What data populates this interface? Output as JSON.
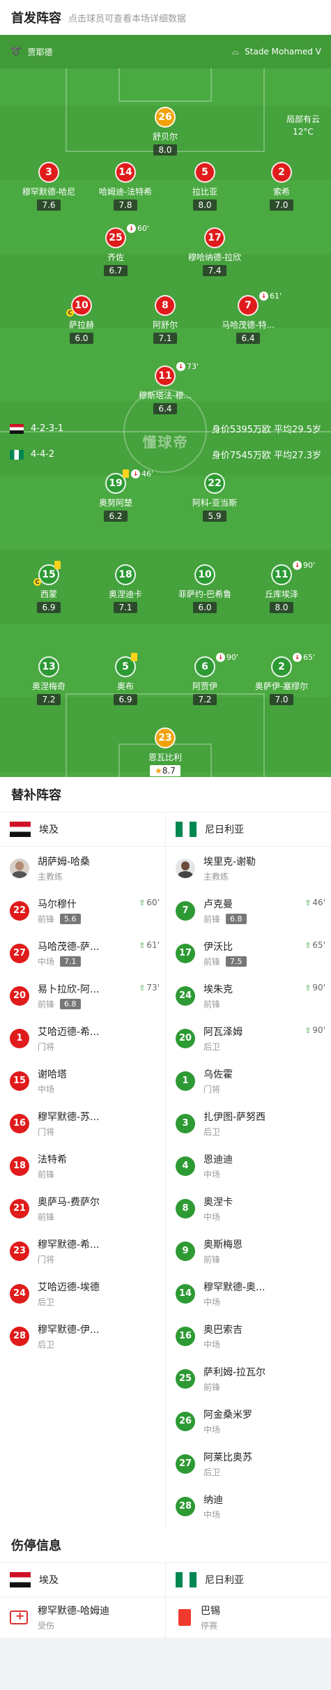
{
  "header": {
    "title": "首发阵容",
    "subtitle": "点击球员可查看本场详细数据"
  },
  "pitch": {
    "coach_home": "贾耶德",
    "venue": "Stade Mohamed V",
    "weather": {
      "line1": "局部有云",
      "line2": "12°C"
    },
    "watermark": "懂球帝",
    "home_formation": "4-2-3-1",
    "home_value": "身价5395万欧",
    "home_age": "平均29.5岁",
    "away_formation": "4-4-2",
    "away_value": "身价7545万欧",
    "away_age": "平均27.3岁"
  },
  "home_players": [
    {
      "num": "26",
      "name": "舒贝尔",
      "rating": "8.0"
    },
    {
      "num": "3",
      "name": "穆罕默德-哈尼",
      "rating": "7.6"
    },
    {
      "num": "14",
      "name": "哈姆迪-法特希",
      "rating": "7.8"
    },
    {
      "num": "5",
      "name": "拉比亚",
      "rating": "8.0"
    },
    {
      "num": "2",
      "name": "索希",
      "rating": "7.0"
    },
    {
      "num": "25",
      "name": "齐佐",
      "rating": "6.7",
      "sub": "60'"
    },
    {
      "num": "17",
      "name": "穆哈纳德-拉欣",
      "rating": "7.4"
    },
    {
      "num": "10",
      "name": "萨拉赫",
      "rating": "6.0"
    },
    {
      "num": "8",
      "name": "阿舒尔",
      "rating": "7.1"
    },
    {
      "num": "7",
      "name": "马哈茂德-特...",
      "rating": "6.4",
      "sub": "61'"
    },
    {
      "num": "11",
      "name": "穆斯塔法-穆...",
      "rating": "6.4",
      "sub": "73'"
    }
  ],
  "away_players": [
    {
      "num": "19",
      "name": "奥努阿楚",
      "rating": "6.2",
      "sub": "46'"
    },
    {
      "num": "22",
      "name": "阿科-亚当斯",
      "rating": "5.9"
    },
    {
      "num": "15",
      "name": "西蒙",
      "rating": "6.9"
    },
    {
      "num": "18",
      "name": "奥涅迪卡",
      "rating": "7.1"
    },
    {
      "num": "10",
      "name": "菲萨约-巴希鲁",
      "rating": "6.0"
    },
    {
      "num": "11",
      "name": "丘库埃泽",
      "rating": "8.0",
      "sub": "90'"
    },
    {
      "num": "13",
      "name": "奥涅梅奇",
      "rating": "7.2"
    },
    {
      "num": "5",
      "name": "奥布",
      "rating": "6.9"
    },
    {
      "num": "6",
      "name": "阿贾伊",
      "rating": "7.2",
      "sub": "90'"
    },
    {
      "num": "2",
      "name": "奥萨伊-塞缪尔",
      "rating": "7.0",
      "sub": "65'"
    },
    {
      "num": "23",
      "name": "恩瓦比利",
      "rating": "8.7"
    }
  ],
  "subs": {
    "title": "替补阵容",
    "home_team": "埃及",
    "away_team": "尼日利亚",
    "home": [
      {
        "num": "",
        "name": "胡萨姆-哈桑",
        "pos": "主教练",
        "coach": true
      },
      {
        "num": "22",
        "name": "马尔穆什",
        "pos": "前锋",
        "rating": "5.6",
        "time": "60'"
      },
      {
        "num": "27",
        "name": "马哈茂德-萨...",
        "pos": "中场",
        "rating": "7.1",
        "time": "61'"
      },
      {
        "num": "20",
        "name": "易卜拉欣-阿...",
        "pos": "前锋",
        "rating": "6.8",
        "time": "73'"
      },
      {
        "num": "1",
        "name": "艾哈迈德-希...",
        "pos": "门将"
      },
      {
        "num": "15",
        "name": "谢哈塔",
        "pos": "中场"
      },
      {
        "num": "16",
        "name": "穆罕默德-苏...",
        "pos": "门将"
      },
      {
        "num": "18",
        "name": "法特希",
        "pos": "前锋"
      },
      {
        "num": "21",
        "name": "奥萨马-费萨尔",
        "pos": "前锋"
      },
      {
        "num": "23",
        "name": "穆罕默德-希...",
        "pos": "门将"
      },
      {
        "num": "24",
        "name": "艾哈迈德-埃德",
        "pos": "后卫"
      },
      {
        "num": "28",
        "name": "穆罕默德-伊...",
        "pos": "后卫"
      }
    ],
    "away": [
      {
        "num": "",
        "name": "埃里克-谢勒",
        "pos": "主教练",
        "coach": true
      },
      {
        "num": "7",
        "name": "卢克曼",
        "pos": "前锋",
        "rating": "6.8",
        "time": "46'"
      },
      {
        "num": "17",
        "name": "伊沃比",
        "pos": "前锋",
        "rating": "7.5",
        "time": "65'"
      },
      {
        "num": "24",
        "name": "埃朱克",
        "pos": "前锋",
        "time": "90'"
      },
      {
        "num": "20",
        "name": "阿瓦泽姆",
        "pos": "后卫",
        "time": "90'"
      },
      {
        "num": "1",
        "name": "乌佐霍",
        "pos": "门将"
      },
      {
        "num": "3",
        "name": "扎伊图-萨努西",
        "pos": "后卫"
      },
      {
        "num": "4",
        "name": "恩迪迪",
        "pos": "中场"
      },
      {
        "num": "8",
        "name": "奥涅卡",
        "pos": "中场"
      },
      {
        "num": "9",
        "name": "奥斯梅恩",
        "pos": "前锋"
      },
      {
        "num": "14",
        "name": "穆罕默德-奥...",
        "pos": "中场"
      },
      {
        "num": "16",
        "name": "奥巴索吉",
        "pos": "中场"
      },
      {
        "num": "25",
        "name": "萨利姆-拉瓦尔",
        "pos": "前锋"
      },
      {
        "num": "26",
        "name": "阿金桑米罗",
        "pos": "中场"
      },
      {
        "num": "27",
        "name": "阿莱比奥苏",
        "pos": "后卫"
      },
      {
        "num": "28",
        "name": "纳迪",
        "pos": "中场"
      }
    ]
  },
  "injuries": {
    "title": "伤停信息",
    "home_team": "埃及",
    "away_team": "尼日利亚",
    "home": [
      {
        "name": "穆罕默德-哈姆迪",
        "status": "受伤"
      }
    ],
    "away": [
      {
        "name": "巴锡",
        "status": "停赛"
      }
    ]
  },
  "colors": {
    "pitch": "#4aa941",
    "home": "#e01b1b",
    "away": "#2d9a33",
    "keeper": "#f1a20b"
  }
}
